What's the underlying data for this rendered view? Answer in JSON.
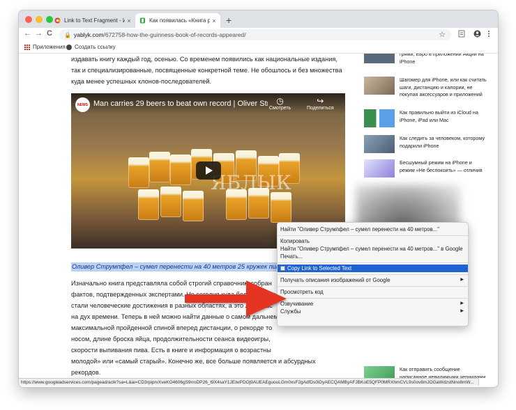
{
  "tabs": [
    {
      "label": "Link to Text Fragment - Интер...",
      "icon": "chrome-web-store-icon",
      "close": "×"
    },
    {
      "label": "Как появилась «Книга рекорд...",
      "icon": "yablyk-favicon-icon",
      "close": "×"
    }
  ],
  "new_tab": "+",
  "toolbar": {
    "back": "←",
    "forward": "→",
    "reload": "C",
    "lock": "🔒",
    "url_host": "yablyk.com",
    "url_path": "/672758-how-the-guinness-book-of-records-appeared/",
    "bookmark_star": "☆"
  },
  "bookmarks": [
    {
      "label": "Приложения",
      "icon": "apps-grid-icon"
    },
    {
      "label": "Создать ссылку",
      "icon": "globe-icon"
    }
  ],
  "article": {
    "para1": [
      "издавать книгу каждый год, осенью. Со временем появились как национальные издания,",
      "так и специализированные, посвященные конкретной теме. Не обошлось и без множества",
      "куда менее успешных клонов-последователей."
    ],
    "video_title": "Man carries 29 beers to beat own record | Oliver Struemp...",
    "video_logo": "NEWS",
    "video_watch": "Смотреть",
    "video_share": "Поделиться",
    "video_watermark": "ЯБЛЫК",
    "caption": "Оливер Струмпфел – сумел перенести на 40 метров 25 кружек пив",
    "para2": [
      "Изначально книга представляла собой строгий справочник, собран",
      "фактов, подтвержденных экспертами. Но сегодня куда более шокиру",
      "стали человеческие достижения в разных областях, а это лучше вс",
      "на дух времени. Теперь в ней можно найти данные о самом дальнем",
      "максимальной пройденной спиной вперед дистанции, о рекорде то",
      "носом, длине броска яйца, продолжительности сеанса видеоигры, ",
      "скорости выпивания пива. Есть в книге и информация о возрастны",
      "молодой» или «самый старый». Конечно же, все больше появляется и абсурдных",
      "рекордов."
    ]
  },
  "sidebar": [
    {
      "text": "грями, Евро в приложении Акции на iPhone"
    },
    {
      "text": "Шагомер для iPhone, или как считать шаги, дистанцию и калории, не покупая аксессуаров и приложений"
    },
    {
      "text": "Как правильно выйти из iCloud на iPhone, iPad или Mac"
    },
    {
      "text": "Как следить за человеком, которому подарили iPhone"
    },
    {
      "text": "Бесшумный режим на iPhone и режим «Не беспокоить» — отличия"
    },
    {
      "text": "Как отправить сообщение написанное невидимыми чернилами"
    }
  ],
  "context_menu": {
    "items": [
      {
        "label": "Найти \"Оливер Струмпфел – сумел перенести на 40 метров...\"",
        "highlight": false,
        "submenu": false
      },
      {
        "label": "Копировать",
        "highlight": false,
        "submenu": false
      },
      {
        "label": "Найти \"Оливер Струмпфел – сумел перенести на 40 метров...\" в Google",
        "highlight": false,
        "submenu": false
      },
      {
        "label": "Печать...",
        "highlight": false,
        "submenu": false
      },
      {
        "label": "Copy Link to Selected Text",
        "highlight": true,
        "submenu": false
      },
      {
        "label": "Получать описания изображений от Google",
        "highlight": false,
        "submenu": true
      },
      {
        "label": "Просмотреть код",
        "highlight": false,
        "submenu": false
      },
      {
        "label": "Озвучивание",
        "highlight": false,
        "submenu": true
      },
      {
        "label": "Службы",
        "highlight": false,
        "submenu": true
      }
    ],
    "highlight_color": "#1e63d1"
  },
  "status_url": "https://www.googleadservices.com/pagead/aclk?sa=L&ai=CD3rpiprvXveKO4606gS9rroDP26_t9X4saY1JEIwPDOj9AUEAEguouLGm0xsF2gAdfDs0iDyAECQAMByAFJBKoE5QFP0MRXhmCVL9s0ov8mJOGaWdzstNno8mW...",
  "colors": {
    "arrow": "#e53524",
    "selection": "#b9d4f1",
    "tabstrip": "#dee1e6"
  }
}
